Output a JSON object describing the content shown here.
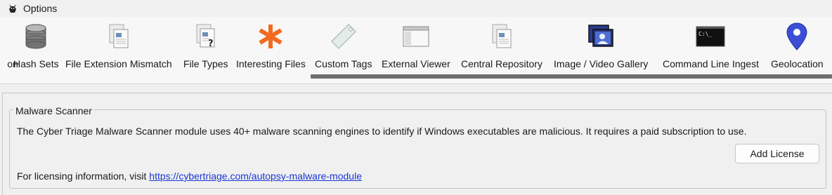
{
  "window": {
    "title": "Options",
    "icon": "autopsy-dog-icon"
  },
  "toolbar": {
    "items": [
      {
        "label": "on",
        "icon": "partial-icon"
      },
      {
        "label": "Hash Sets",
        "icon": "database-icon"
      },
      {
        "label": "File Extension Mismatch",
        "icon": "documents-icon"
      },
      {
        "label": "File Types",
        "icon": "document-question-icon"
      },
      {
        "label": "Interesting Files",
        "icon": "asterisk-icon"
      },
      {
        "label": "Custom Tags",
        "icon": "tag-icon"
      },
      {
        "label": "External Viewer",
        "icon": "window-icon"
      },
      {
        "label": "Central Repository",
        "icon": "documents-icon"
      },
      {
        "label": "Image / Video Gallery",
        "icon": "picture-gallery-icon"
      },
      {
        "label": "Command Line Ingest",
        "icon": "terminal-icon"
      },
      {
        "label": "Geolocation",
        "icon": "map-pin-icon"
      }
    ]
  },
  "malware_panel": {
    "legend": "Malware Scanner",
    "description": "The Cyber Triage Malware Scanner module uses 40+ malware scanning engines to identify if Windows executables are malicious. It requires a paid subscription to use.",
    "button_label": "Add License",
    "licensing_prefix": "For licensing information, visit ",
    "licensing_link": "https://cybertriage.com/autopsy-malware-module"
  },
  "colors": {
    "link": "#1a35d4",
    "asterisk": "#f26a21",
    "pin": "#3b4fd6"
  }
}
